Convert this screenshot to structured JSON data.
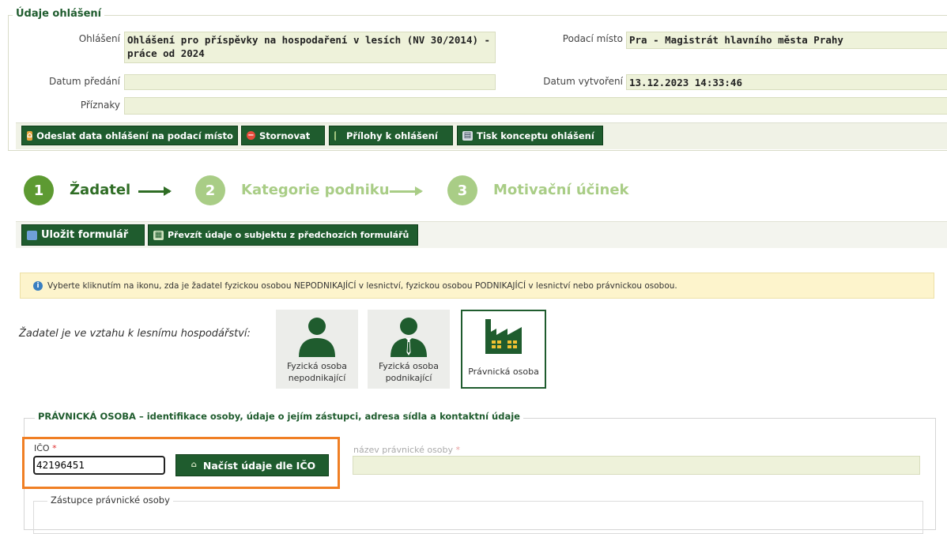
{
  "header": {
    "legend": "Údaje ohlášení",
    "ohlaseni_label": "Ohlášení",
    "ohlaseni_value_line1": "Ohlášení pro příspěvky na hospodaření v lesích (NV 30/2014) -",
    "ohlaseni_value_line2": "práce od 2024",
    "podaci_misto_label": "Podací místo",
    "podaci_misto_value": "Pra - Magistrát hlavního města Prahy",
    "datum_predani_label": "Datum předání",
    "datum_predani_value": "",
    "datum_vytvoreni_label": "Datum vytvoření",
    "datum_vytvoreni_value": "13.12.2023 14:33:46",
    "priznaky_label": "Příznaky",
    "priznaky_value": ""
  },
  "toolbar": {
    "send_label": "Odeslat data ohlášení na podací místo",
    "cancel_label": "Stornovat",
    "attachments_label": "Přílohy k ohlášení",
    "print_label": "Tisk konceptu ohlášení"
  },
  "steps": [
    {
      "number": "1",
      "label": "Žadatel",
      "active": true
    },
    {
      "number": "2",
      "label": "Kategorie podniku",
      "active": false
    },
    {
      "number": "3",
      "label": "Motivační účinek",
      "active": false
    }
  ],
  "form_toolbar": {
    "save_label": "Uložit formulář",
    "import_label": "Převzít údaje o subjektu z předchozích formulářů"
  },
  "info_text": "Vyberte kliknutím na ikonu, zda je žadatel fyzickou osobou NEPODNIKAJÍCÍ v lesnictví, fyzickou osobou PODNIKAJÍCÍ v lesnictví nebo právnickou osobou.",
  "relation": {
    "label": "Žadatel je ve vztahu k lesnímu hospodářství:",
    "options": [
      {
        "line1": "Fyzická osoba",
        "line2": "nepodnikající",
        "selected": false
      },
      {
        "line1": "Fyzická osoba",
        "line2": "podnikající",
        "selected": false
      },
      {
        "line1": "Právnická osoba",
        "line2": "",
        "selected": true
      }
    ]
  },
  "legal_entity": {
    "legend": "PRÁVNICKÁ OSOBA – identifikace osoby, údaje o jejím zástupci, adresa sídla a kontaktní údaje",
    "ico_label": "IČO",
    "required_mark": "*",
    "ico_value": "42196451",
    "load_button_label": "Načíst údaje dle IČO",
    "name_label": "název právnické osoby",
    "name_value": "",
    "representative_legend": "Zástupce právnické osoby"
  },
  "colors": {
    "brand_green": "#1f5c2e",
    "step_inactive": "#a9cd86",
    "highlight_orange": "#f07f24",
    "field_bg": "#eef2da"
  }
}
